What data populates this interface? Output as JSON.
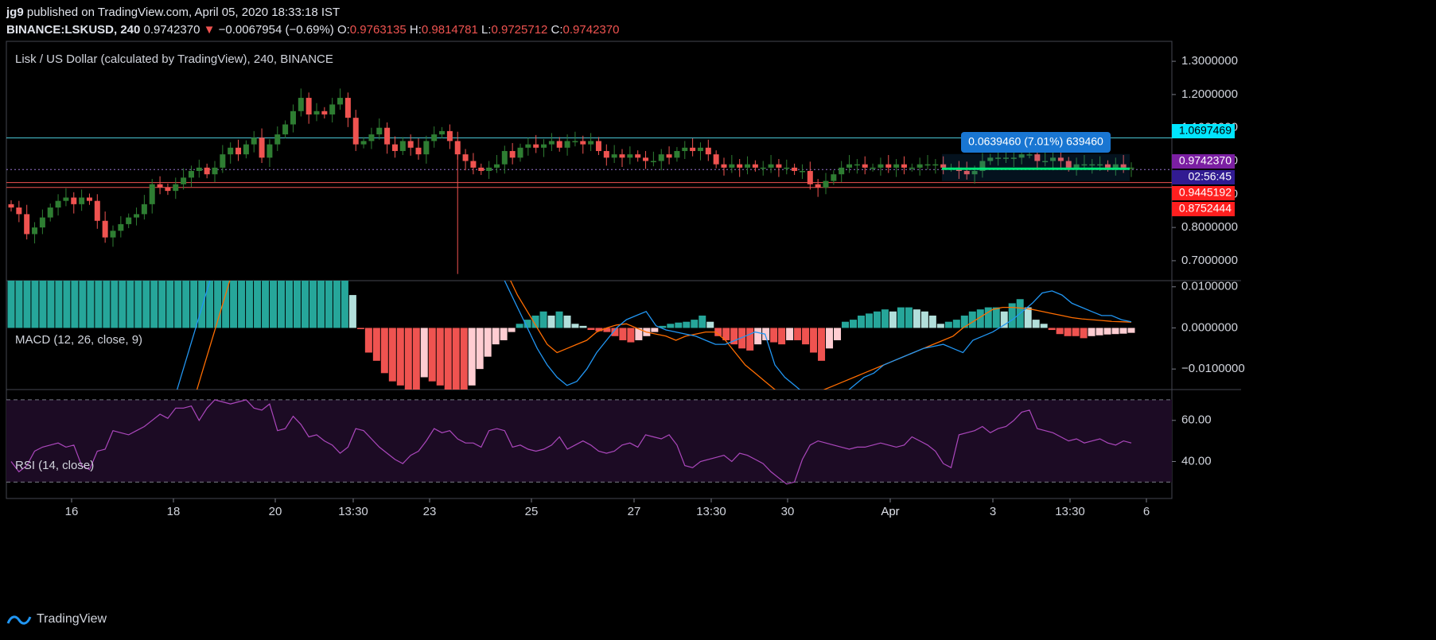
{
  "header": {
    "publisher": "jg9",
    "published_text": "published on TradingView.com, April 05, 2020 18:33:18 IST",
    "symbol": "BINANCE:LSKUSD, 240",
    "last": "0.9742370",
    "arrow": "▼",
    "change": "−0.0067954 (−0.69%)",
    "o_label": "O:",
    "o": "0.9763135",
    "h_label": "H:",
    "h": "0.9814781",
    "l_label": "L:",
    "l": "0.9725712",
    "c_label": "C:",
    "c": "0.9742370"
  },
  "colors": {
    "up": "#26a69a",
    "up_dark": "#1e6b3a",
    "down": "#ef5350",
    "up_candle": "#2e7d32",
    "price_line": "#ffffff",
    "cyan_line": "#4dd0e1",
    "red_line": "#ef5350",
    "macd_line": "#2196f3",
    "signal_line": "#ff6d00",
    "rsi": "#ab47bc",
    "rsi_band": "#1c0b24",
    "purple_tag": "#7e57c2",
    "measure": "#1976d2"
  },
  "chart_data": [
    {
      "type": "candlestick",
      "title": "Lisk / US Dollar (calculated by TradingView), 240, BINANCE",
      "ylim": [
        0.64,
        1.36
      ],
      "yticks": [
        "1.3000000",
        "1.2000000",
        "1.1000000",
        "1.0000000",
        "0.9000000",
        "0.8000000",
        "0.7000000"
      ],
      "ytick_values": [
        1.3,
        1.2,
        1.1,
        1.0,
        0.9,
        0.8,
        0.7
      ],
      "xticks": [
        "16",
        "18",
        "20",
        "13:30",
        "23",
        "25",
        "27",
        "13:30",
        "30",
        "Apr",
        "3",
        "13:30",
        "6"
      ],
      "levels": {
        "cyan": 1.0697469,
        "red1": 0.9445192,
        "red2": 0.8752444,
        "last": 0.974237
      },
      "price_tags": [
        {
          "label": "1.0697469",
          "value": 1.0697469,
          "color": "#00e5ff",
          "text": "#000"
        },
        {
          "label": "0.9742370",
          "value": 0.974237,
          "color": "#7b1fa2",
          "text": "#fff"
        },
        {
          "label": "02:56:45",
          "value": 0.945,
          "color": "#311b92",
          "text": "#fff"
        },
        {
          "label": "0.9445192",
          "value": 0.9445192,
          "color": "#ff1f1f",
          "text": "#fff"
        },
        {
          "label": "0.8752444",
          "value": 0.8752444,
          "color": "#ff1f1f",
          "text": "#fff"
        }
      ],
      "measure_label": "0.0639460 (7.01%) 639460",
      "closes": [
        0.86,
        0.84,
        0.78,
        0.8,
        0.83,
        0.86,
        0.88,
        0.89,
        0.87,
        0.89,
        0.88,
        0.82,
        0.77,
        0.79,
        0.81,
        0.83,
        0.84,
        0.87,
        0.93,
        0.92,
        0.91,
        0.93,
        0.95,
        0.97,
        0.98,
        0.96,
        0.98,
        1.02,
        1.04,
        1.02,
        1.05,
        1.07,
        1.01,
        1.05,
        1.08,
        1.11,
        1.15,
        1.19,
        1.14,
        1.15,
        1.14,
        1.17,
        1.19,
        1.13,
        1.05,
        1.06,
        1.08,
        1.1,
        1.05,
        1.03,
        1.06,
        1.04,
        1.02,
        1.06,
        1.08,
        1.09,
        1.06,
        1.02,
        1.0,
        0.98,
        0.97,
        0.98,
        0.99,
        1.03,
        1.01,
        1.04,
        1.05,
        1.04,
        1.05,
        1.06,
        1.04,
        1.06,
        1.06,
        1.05,
        1.06,
        1.03,
        1.01,
        1.02,
        1.01,
        1.02,
        1.01,
        1.0,
        1.0,
        1.02,
        1.01,
        1.03,
        1.04,
        1.03,
        1.04,
        1.02,
        0.99,
        0.98,
        0.99,
        0.98,
        0.99,
        0.98,
        0.98,
        0.99,
        0.98,
        0.98,
        0.97,
        0.97,
        0.93,
        0.92,
        0.94,
        0.96,
        0.98,
        0.99,
        0.99,
        0.98,
        0.98,
        0.99,
        0.98,
        0.99,
        0.98,
        0.98,
        0.99,
        0.99,
        0.99,
        0.98,
        0.98,
        0.97,
        0.96,
        0.97,
        1.0,
        1.01,
        1.01,
        1.01,
        1.01,
        1.02,
        1.02,
        1.0,
        1.0,
        1.01,
        1.0,
        0.98,
        0.99,
        0.99,
        0.99,
        0.99,
        0.98,
        0.99,
        0.98,
        0.98
      ],
      "big_wick": {
        "index": 57,
        "low": 0.66,
        "high": 1.05
      }
    },
    {
      "type": "macd",
      "title": "MACD (12, 26, close, 9)",
      "ylim": [
        -0.015,
        0.0115
      ],
      "yticks": [
        "0.0100000",
        "0.0000000",
        "−0.0100000"
      ],
      "ytick_values": [
        0.01,
        0.0,
        -0.01
      ],
      "histogram": [
        0.012,
        0.012,
        0.012,
        0.012,
        0.012,
        0.012,
        0.012,
        0.012,
        0.012,
        0.012,
        0.012,
        0.012,
        0.012,
        0.012,
        0.012,
        0.012,
        0.012,
        0.012,
        0.012,
        0.012,
        0.012,
        0.012,
        0.012,
        0.012,
        0.012,
        0.012,
        0.012,
        0.012,
        0.012,
        0.012,
        0.012,
        0.012,
        0.012,
        0.012,
        0.012,
        0.012,
        0.012,
        0.012,
        0.012,
        0.012,
        0.012,
        0.012,
        0.012,
        0.008,
        -0.0003,
        -0.006,
        -0.008,
        -0.011,
        -0.013,
        -0.014,
        -0.015,
        -0.015,
        -0.012,
        -0.013,
        -0.014,
        -0.015,
        -0.016,
        -0.016,
        -0.014,
        -0.01,
        -0.007,
        -0.004,
        -0.003,
        -0.001,
        0.001,
        0.002,
        0.003,
        0.004,
        0.003,
        0.004,
        0.003,
        0.001,
        0.0005,
        -0.0005,
        -0.0008,
        -0.001,
        -0.002,
        -0.003,
        -0.0035,
        -0.003,
        -0.002,
        -0.001,
        0.0005,
        0.001,
        0.0013,
        0.0015,
        0.002,
        0.003,
        0.0015,
        -0.002,
        -0.003,
        -0.004,
        -0.005,
        -0.0055,
        -0.004,
        -0.003,
        -0.0035,
        -0.004,
        -0.003,
        -0.003,
        -0.004,
        -0.006,
        -0.008,
        -0.005,
        -0.003,
        0.0015,
        0.002,
        0.003,
        0.0035,
        0.004,
        0.0045,
        0.004,
        0.005,
        0.005,
        0.0045,
        0.004,
        0.003,
        0.001,
        0.0015,
        0.002,
        0.003,
        0.004,
        0.0045,
        0.005,
        0.005,
        0.004,
        0.006,
        0.007,
        0.005,
        0.002,
        0.001,
        -0.0005,
        -0.0015,
        -0.002,
        -0.002,
        -0.0025,
        -0.002,
        -0.0018,
        -0.0016,
        -0.0015,
        -0.0014,
        -0.0012
      ],
      "macd": [
        -0.03,
        -0.025,
        -0.02,
        -0.012,
        -0.004,
        0.004,
        0.012,
        0.02,
        0.028,
        0.035,
        0.04,
        0.04,
        0.04,
        0.04,
        0.04,
        0.04,
        0.04,
        0.04,
        0.04,
        0.04,
        0.04,
        0.04,
        0.04,
        0.04,
        0.04,
        0.04,
        0.04,
        0.04,
        0.04,
        0.04,
        0.04,
        0.04,
        0.03,
        0.025,
        0.02,
        0.015,
        0.01,
        0.005,
        0.0,
        -0.005,
        -0.009,
        -0.012,
        -0.014,
        -0.013,
        -0.01,
        -0.006,
        -0.003,
        0.0,
        0.002,
        0.003,
        0.004,
        0.0005,
        -0.0005,
        -0.001,
        -0.0015,
        -0.002,
        -0.003,
        -0.004,
        -0.004,
        -0.003,
        -0.002,
        -0.001,
        -0.0015,
        -0.009,
        -0.012,
        -0.014,
        -0.016,
        -0.018,
        -0.019,
        -0.02,
        -0.016,
        -0.014,
        -0.012,
        -0.011,
        -0.009,
        -0.008,
        -0.007,
        -0.006,
        -0.005,
        -0.0045,
        -0.004,
        -0.005,
        -0.006,
        -0.003,
        -0.002,
        -0.001,
        0.0005,
        0.002,
        0.004,
        0.006,
        0.0085,
        0.009,
        0.008,
        0.006,
        0.005,
        0.004,
        0.003,
        0.003,
        0.002,
        0.0015
      ],
      "signal": [
        -0.04,
        -0.036,
        -0.032,
        -0.027,
        -0.02,
        -0.012,
        -0.004,
        0.004,
        0.012,
        0.02,
        0.026,
        0.03,
        0.033,
        0.035,
        0.037,
        0.038,
        0.038,
        0.038,
        0.038,
        0.038,
        0.038,
        0.038,
        0.038,
        0.038,
        0.038,
        0.038,
        0.038,
        0.038,
        0.038,
        0.038,
        0.038,
        0.037,
        0.034,
        0.03,
        0.024,
        0.018,
        0.013,
        0.008,
        0.004,
        0.0,
        -0.004,
        -0.006,
        -0.005,
        -0.004,
        -0.003,
        -0.001,
        0.0,
        0.0007,
        0.001,
        0.0,
        -0.001,
        -0.0015,
        -0.002,
        -0.003,
        -0.002,
        -0.0015,
        -0.001,
        -0.001,
        -0.003,
        -0.006,
        -0.009,
        -0.011,
        -0.013,
        -0.015,
        -0.016,
        -0.017,
        -0.017,
        -0.016,
        -0.015,
        -0.014,
        -0.013,
        -0.012,
        -0.011,
        -0.01,
        -0.009,
        -0.008,
        -0.007,
        -0.006,
        -0.005,
        -0.004,
        -0.003,
        -0.002,
        0.0,
        0.0015,
        0.003,
        0.0045,
        0.005,
        0.005,
        0.0048,
        0.0045,
        0.004,
        0.0035,
        0.003,
        0.0025,
        0.0022,
        0.002,
        0.0018,
        0.0016,
        0.0015,
        0.0014
      ]
    },
    {
      "type": "rsi",
      "title": "RSI (14, close)",
      "ylim": [
        22,
        75
      ],
      "yticks": [
        "60.00",
        "40.00"
      ],
      "ytick_values": [
        60,
        40
      ],
      "bands": [
        70,
        30
      ],
      "values": [
        40,
        35,
        38,
        45,
        47,
        48,
        49,
        47,
        48,
        38,
        36,
        45,
        46,
        55,
        54,
        53,
        55,
        57,
        60,
        63,
        61,
        66,
        66,
        67,
        60,
        66,
        70,
        69,
        68,
        69,
        70,
        66,
        65,
        68,
        55,
        56,
        62,
        58,
        52,
        53,
        50,
        48,
        44,
        47,
        56,
        55,
        51,
        47,
        44,
        41,
        39,
        43,
        45,
        50,
        56,
        54,
        55,
        51,
        49,
        49,
        47,
        55,
        56,
        55,
        47,
        48,
        46,
        45,
        46,
        48,
        52,
        46,
        48,
        50,
        48,
        45,
        44,
        45,
        48,
        49,
        47,
        53,
        52,
        51,
        53,
        48,
        38,
        37,
        40,
        41,
        42,
        43,
        40,
        44,
        43,
        41,
        39,
        35,
        32,
        29,
        30,
        41,
        48,
        50,
        49,
        48,
        47,
        46,
        47,
        47,
        48,
        49,
        48,
        47,
        48,
        52,
        50,
        48,
        45,
        39,
        37,
        53,
        54,
        55,
        57,
        54,
        56,
        57,
        60,
        64,
        65,
        56,
        55,
        54,
        52,
        50,
        51,
        49,
        50,
        51,
        49,
        48,
        50,
        49
      ]
    }
  ],
  "footer": {
    "brand": "TradingView"
  }
}
